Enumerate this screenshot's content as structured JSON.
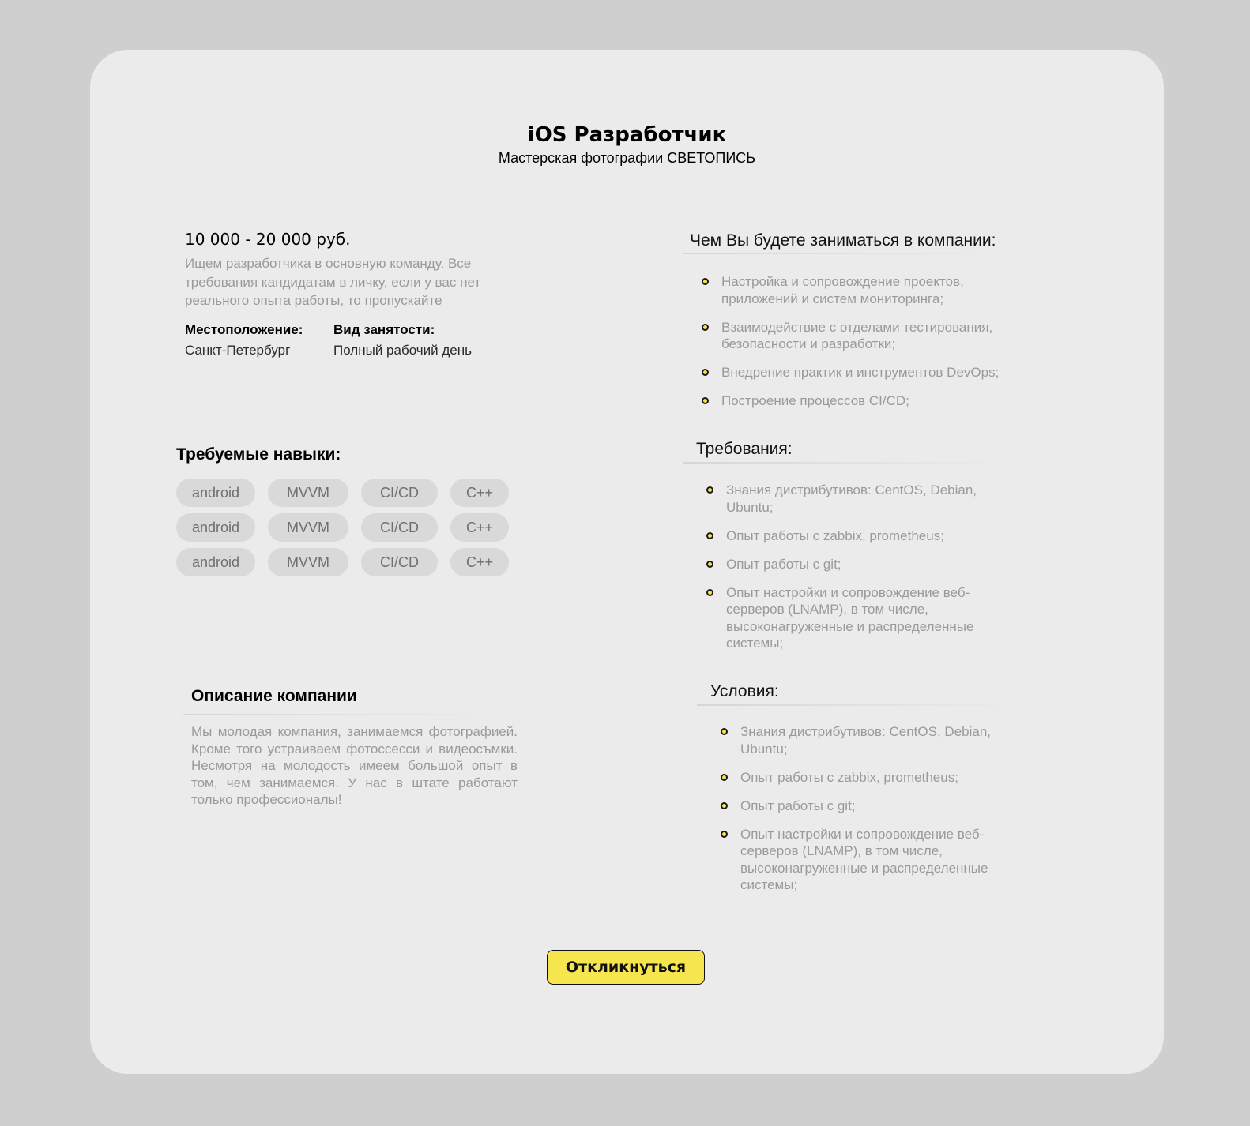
{
  "vacancy": {
    "title": "iOS Разработчик",
    "company": "Мастерская фотографии СВЕТОПИСЬ",
    "salary": "10 000 - 20 000 руб.",
    "summary": "Ищем разработчика в основную  команду. Все требования кандидатам в личку, если у вас нет реального опыта работы, то пропускайте",
    "location_label": "Местоположение:",
    "location_value": "Санкт-Петербург",
    "employment_label": "Вид занятости:",
    "employment_value": "Полный рабочий день"
  },
  "skills": {
    "title": "Требуемые навыки:",
    "rows": [
      [
        "android",
        "MVVM",
        "CI/CD",
        "C++"
      ],
      [
        "android",
        "MVVM",
        "CI/CD",
        "C++"
      ],
      [
        "android",
        "MVVM",
        "CI/CD",
        "C++"
      ]
    ]
  },
  "about": {
    "title": "Описание компании",
    "text": "Мы молодая компания, занимаемся фотографией. Кроме того устраиваем фотоссесси и видеосъмки. Несмотря на молодость имеем большой опыт в том, чем занимаемся. У нас в штате работают только профессионалы!"
  },
  "duties": {
    "title": "Чем Вы будете заниматься в компании:",
    "items": [
      "Настройка и сопровождение проектов, приложений и систем мониторинга;",
      "Взаимодействие с отделами тестирования, безопасности и разработки;",
      "Внедрение практик и инструментов DevOps;",
      "Построение процессов CI/CD;"
    ]
  },
  "requirements": {
    "title": "Требования:",
    "items": [
      "Знания дистрибутивов: CentOS, Debian, Ubuntu;",
      "Опыт работы с zabbix, prometheus;",
      "Опыт работы с git;",
      "Опыт настройки и сопровождение веб-серверов (LNAMP), в том числе, высоконагруженные и распределенные системы;"
    ]
  },
  "conditions": {
    "title": "Условия:",
    "items": [
      "Знания дистрибутивов: CentOS, Debian, Ubuntu;",
      "Опыт работы с zabbix, prometheus;",
      "Опыт работы с git;",
      "Опыт настройки и сопровождение веб-серверов (LNAMP), в том числе, высоконагруженные и распределенные системы;"
    ]
  },
  "actions": {
    "apply_label": "Откликнуться"
  },
  "colors": {
    "page_background": "#cfcfcf",
    "card_background": "#ebebeb",
    "accent_yellow": "#f7e54f",
    "chip_background": "#d9d9d9",
    "muted_text": "#9a9a9a"
  }
}
